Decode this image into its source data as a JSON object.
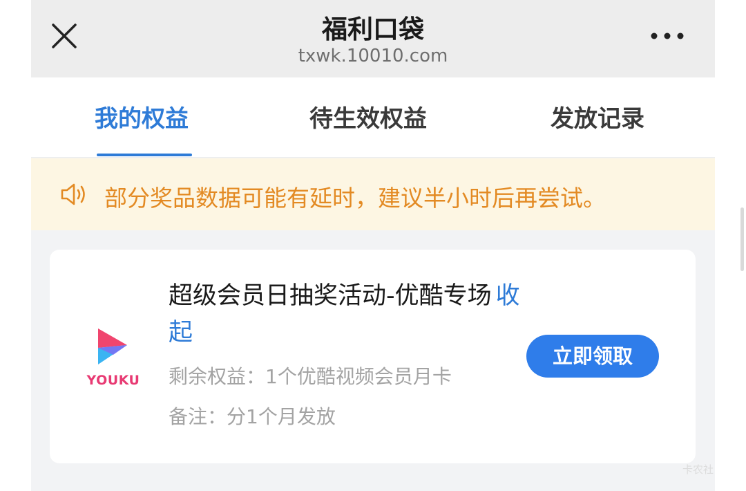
{
  "header": {
    "title": "福利口袋",
    "url": "txwk.10010.com",
    "close_icon": "close-icon",
    "more_icon": "more-dots-icon"
  },
  "tabs": [
    {
      "label": "我的权益",
      "active": true
    },
    {
      "label": "待生效权益",
      "active": false
    },
    {
      "label": "发放记录",
      "active": false
    }
  ],
  "notice": {
    "icon": "speaker-icon",
    "text": "部分奖品数据可能有延时，建议半小时后再尝试。"
  },
  "card": {
    "logo_text": "YOUKU",
    "title": "超级会员日抽奖活动-优酷专场",
    "collapse_label": "收起",
    "remaining": "剩余权益：1个优酷视频会员月卡",
    "note": "备注：分1个月发放",
    "claim_label": "立即领取"
  },
  "watermark": "卡农社",
  "colors": {
    "accent": "#2e7bd7",
    "notice_text": "#e38a23",
    "notice_bg": "#fdf6e3",
    "button": "#2f7dea"
  }
}
